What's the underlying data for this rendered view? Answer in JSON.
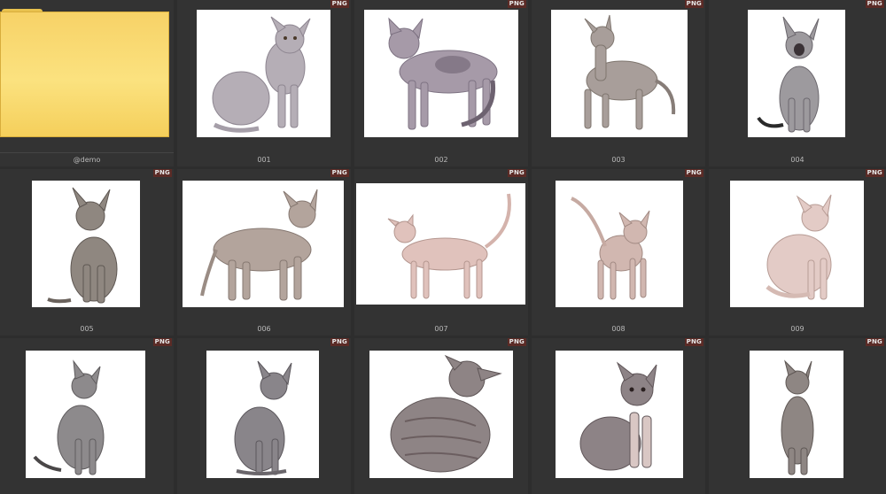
{
  "folder": {
    "name": "@demo",
    "icon": "folder-icon",
    "color": "#f9d86f"
  },
  "badge_color": "#5b2b26",
  "items": [
    {
      "name": "001",
      "format": "PNG"
    },
    {
      "name": "002",
      "format": "PNG"
    },
    {
      "name": "003",
      "format": "PNG"
    },
    {
      "name": "004",
      "format": "PNG"
    },
    {
      "name": "005",
      "format": "PNG"
    },
    {
      "name": "006",
      "format": "PNG"
    },
    {
      "name": "007",
      "format": "PNG"
    },
    {
      "name": "008",
      "format": "PNG"
    },
    {
      "name": "009",
      "format": "PNG"
    },
    {
      "name": "",
      "format": "PNG"
    },
    {
      "name": "",
      "format": "PNG"
    },
    {
      "name": "",
      "format": "PNG"
    },
    {
      "name": "",
      "format": "PNG"
    },
    {
      "name": "",
      "format": "PNG"
    }
  ]
}
